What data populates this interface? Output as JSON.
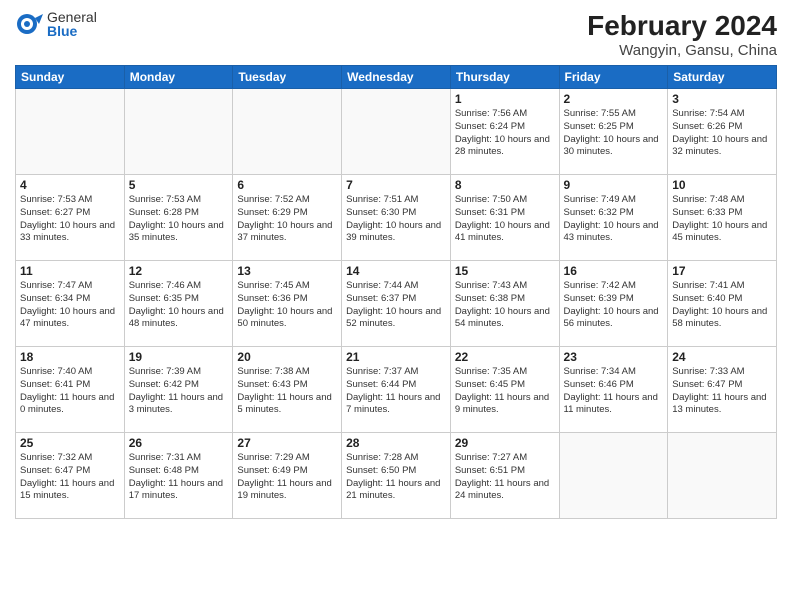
{
  "header": {
    "logo": {
      "general": "General",
      "blue": "Blue"
    },
    "title": "February 2024",
    "subtitle": "Wangyin, Gansu, China"
  },
  "weekdays": [
    "Sunday",
    "Monday",
    "Tuesday",
    "Wednesday",
    "Thursday",
    "Friday",
    "Saturday"
  ],
  "weeks": [
    [
      {
        "day": "",
        "detail": ""
      },
      {
        "day": "",
        "detail": ""
      },
      {
        "day": "",
        "detail": ""
      },
      {
        "day": "",
        "detail": ""
      },
      {
        "day": "1",
        "detail": "Sunrise: 7:56 AM\nSunset: 6:24 PM\nDaylight: 10 hours\nand 28 minutes."
      },
      {
        "day": "2",
        "detail": "Sunrise: 7:55 AM\nSunset: 6:25 PM\nDaylight: 10 hours\nand 30 minutes."
      },
      {
        "day": "3",
        "detail": "Sunrise: 7:54 AM\nSunset: 6:26 PM\nDaylight: 10 hours\nand 32 minutes."
      }
    ],
    [
      {
        "day": "4",
        "detail": "Sunrise: 7:53 AM\nSunset: 6:27 PM\nDaylight: 10 hours\nand 33 minutes."
      },
      {
        "day": "5",
        "detail": "Sunrise: 7:53 AM\nSunset: 6:28 PM\nDaylight: 10 hours\nand 35 minutes."
      },
      {
        "day": "6",
        "detail": "Sunrise: 7:52 AM\nSunset: 6:29 PM\nDaylight: 10 hours\nand 37 minutes."
      },
      {
        "day": "7",
        "detail": "Sunrise: 7:51 AM\nSunset: 6:30 PM\nDaylight: 10 hours\nand 39 minutes."
      },
      {
        "day": "8",
        "detail": "Sunrise: 7:50 AM\nSunset: 6:31 PM\nDaylight: 10 hours\nand 41 minutes."
      },
      {
        "day": "9",
        "detail": "Sunrise: 7:49 AM\nSunset: 6:32 PM\nDaylight: 10 hours\nand 43 minutes."
      },
      {
        "day": "10",
        "detail": "Sunrise: 7:48 AM\nSunset: 6:33 PM\nDaylight: 10 hours\nand 45 minutes."
      }
    ],
    [
      {
        "day": "11",
        "detail": "Sunrise: 7:47 AM\nSunset: 6:34 PM\nDaylight: 10 hours\nand 47 minutes."
      },
      {
        "day": "12",
        "detail": "Sunrise: 7:46 AM\nSunset: 6:35 PM\nDaylight: 10 hours\nand 48 minutes."
      },
      {
        "day": "13",
        "detail": "Sunrise: 7:45 AM\nSunset: 6:36 PM\nDaylight: 10 hours\nand 50 minutes."
      },
      {
        "day": "14",
        "detail": "Sunrise: 7:44 AM\nSunset: 6:37 PM\nDaylight: 10 hours\nand 52 minutes."
      },
      {
        "day": "15",
        "detail": "Sunrise: 7:43 AM\nSunset: 6:38 PM\nDaylight: 10 hours\nand 54 minutes."
      },
      {
        "day": "16",
        "detail": "Sunrise: 7:42 AM\nSunset: 6:39 PM\nDaylight: 10 hours\nand 56 minutes."
      },
      {
        "day": "17",
        "detail": "Sunrise: 7:41 AM\nSunset: 6:40 PM\nDaylight: 10 hours\nand 58 minutes."
      }
    ],
    [
      {
        "day": "18",
        "detail": "Sunrise: 7:40 AM\nSunset: 6:41 PM\nDaylight: 11 hours\nand 0 minutes."
      },
      {
        "day": "19",
        "detail": "Sunrise: 7:39 AM\nSunset: 6:42 PM\nDaylight: 11 hours\nand 3 minutes."
      },
      {
        "day": "20",
        "detail": "Sunrise: 7:38 AM\nSunset: 6:43 PM\nDaylight: 11 hours\nand 5 minutes."
      },
      {
        "day": "21",
        "detail": "Sunrise: 7:37 AM\nSunset: 6:44 PM\nDaylight: 11 hours\nand 7 minutes."
      },
      {
        "day": "22",
        "detail": "Sunrise: 7:35 AM\nSunset: 6:45 PM\nDaylight: 11 hours\nand 9 minutes."
      },
      {
        "day": "23",
        "detail": "Sunrise: 7:34 AM\nSunset: 6:46 PM\nDaylight: 11 hours\nand 11 minutes."
      },
      {
        "day": "24",
        "detail": "Sunrise: 7:33 AM\nSunset: 6:47 PM\nDaylight: 11 hours\nand 13 minutes."
      }
    ],
    [
      {
        "day": "25",
        "detail": "Sunrise: 7:32 AM\nSunset: 6:47 PM\nDaylight: 11 hours\nand 15 minutes."
      },
      {
        "day": "26",
        "detail": "Sunrise: 7:31 AM\nSunset: 6:48 PM\nDaylight: 11 hours\nand 17 minutes."
      },
      {
        "day": "27",
        "detail": "Sunrise: 7:29 AM\nSunset: 6:49 PM\nDaylight: 11 hours\nand 19 minutes."
      },
      {
        "day": "28",
        "detail": "Sunrise: 7:28 AM\nSunset: 6:50 PM\nDaylight: 11 hours\nand 21 minutes."
      },
      {
        "day": "29",
        "detail": "Sunrise: 7:27 AM\nSunset: 6:51 PM\nDaylight: 11 hours\nand 24 minutes."
      },
      {
        "day": "",
        "detail": ""
      },
      {
        "day": "",
        "detail": ""
      }
    ]
  ]
}
